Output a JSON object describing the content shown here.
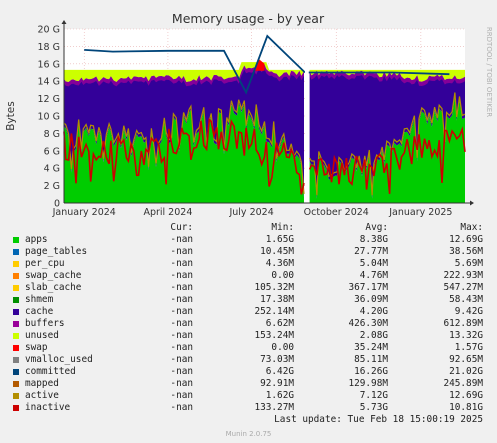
{
  "chart_data": {
    "type": "area",
    "title": "Memory usage - by year",
    "ylabel": "Bytes",
    "watermark": "RRDTOOL / TOBI OETIKER",
    "ylim": [
      0,
      20
    ],
    "y_unit": "G",
    "y_ticks": [
      "0",
      "2 G",
      "4 G",
      "6 G",
      "8 G",
      "10 G",
      "12 G",
      "14 G",
      "16 G",
      "18 G",
      "20 G"
    ],
    "x_ticks": [
      {
        "label": "January 2024",
        "date": "2024-01-01"
      },
      {
        "label": "April 2024",
        "date": "2024-04-01"
      },
      {
        "label": "July 2024",
        "date": "2024-07-01"
      },
      {
        "label": "October 2024",
        "date": "2024-10-01"
      },
      {
        "label": "January 2025",
        "date": "2025-01-01"
      }
    ],
    "x_range": [
      "2023-12-10",
      "2025-02-18"
    ],
    "gap": [
      "2024-08-28",
      "2024-09-01"
    ],
    "stack_top_typical": 15.3,
    "stack_top_july_spike": 16.2,
    "series": [
      {
        "name": "apps",
        "color": "#00cc00",
        "x": [
          "2024-01",
          "2024-03",
          "2024-05",
          "2024-07",
          "2024-09",
          "2024-11",
          "2025-01",
          "2025-02"
        ],
        "values": [
          8.5,
          6.5,
          9.5,
          10.0,
          4.0,
          4.5,
          9.0,
          11.0
        ]
      },
      {
        "name": "cache",
        "color": "#330099",
        "x": [
          "2024-01",
          "2024-03",
          "2024-05",
          "2024-07",
          "2024-09",
          "2024-11",
          "2025-01",
          "2025-02"
        ],
        "values": [
          4.5,
          6.5,
          3.5,
          3.5,
          10.5,
          10.0,
          4.5,
          3.0
        ]
      },
      {
        "name": "unused",
        "color": "#ccff00",
        "x": [
          "2024-01",
          "2024-03",
          "2024-05",
          "2024-07",
          "2024-09",
          "2024-11",
          "2025-01",
          "2025-02"
        ],
        "values": [
          1.0,
          1.0,
          1.0,
          0.6,
          0.3,
          0.3,
          1.0,
          0.8
        ]
      },
      {
        "name": "committed",
        "color": "#00457a",
        "x": [
          "2024-01",
          "2024-02",
          "2024-04",
          "2024-06",
          "2024-06-25",
          "2024-07-18",
          "2024-08-28",
          "2024-09-01",
          "2024-12",
          "2025-02"
        ],
        "values": [
          17.6,
          17.4,
          17.5,
          17.5,
          12.7,
          19.2,
          15.0,
          15.0,
          15.0,
          14.8
        ]
      },
      {
        "name": "inactive",
        "color": "#cc0000",
        "x": [
          "2024-01",
          "2024-03",
          "2024-05",
          "2024-07",
          "2024-09",
          "2024-11",
          "2025-01",
          "2025-02"
        ],
        "values": [
          6.5,
          5.5,
          8.0,
          7.5,
          3.5,
          4.0,
          6.5,
          7.0
        ]
      }
    ]
  },
  "legend": {
    "header": {
      "cur": "Cur:",
      "min": "Min:",
      "avg": "Avg:",
      "max": "Max:"
    },
    "rows": [
      {
        "name": "apps",
        "color": "#00cc00",
        "cur": "-nan",
        "min": "1.65G",
        "avg": "8.38G",
        "max": "12.69G"
      },
      {
        "name": "page_tables",
        "color": "#0066b3",
        "cur": "-nan",
        "min": "10.45M",
        "avg": "27.77M",
        "max": "38.56M"
      },
      {
        "name": "per_cpu",
        "color": "#ffcc00",
        "cur": "-nan",
        "min": "4.36M",
        "avg": "5.04M",
        "max": "5.69M"
      },
      {
        "name": "swap_cache",
        "color": "#ff8000",
        "cur": "-nan",
        "min": "0.00",
        "avg": "4.76M",
        "max": "222.93M"
      },
      {
        "name": "slab_cache",
        "color": "#ffcc00",
        "cur": "-nan",
        "min": "105.32M",
        "avg": "367.17M",
        "max": "547.27M"
      },
      {
        "name": "shmem",
        "color": "#008f00",
        "cur": "-nan",
        "min": "17.38M",
        "avg": "36.09M",
        "max": "58.43M"
      },
      {
        "name": "cache",
        "color": "#330099",
        "cur": "-nan",
        "min": "252.14M",
        "avg": "4.20G",
        "max": "9.42G"
      },
      {
        "name": "buffers",
        "color": "#990099",
        "cur": "-nan",
        "min": "6.62M",
        "avg": "426.30M",
        "max": "612.89M"
      },
      {
        "name": "unused",
        "color": "#ccff00",
        "cur": "-nan",
        "min": "153.24M",
        "avg": "2.08G",
        "max": "13.32G"
      },
      {
        "name": "swap",
        "color": "#ff0000",
        "cur": "-nan",
        "min": "0.00",
        "avg": "35.24M",
        "max": "1.57G"
      },
      {
        "name": "vmalloc_used",
        "color": "#808080",
        "cur": "-nan",
        "min": "73.03M",
        "avg": "85.11M",
        "max": "92.65M"
      },
      {
        "name": "committed",
        "color": "#00457a",
        "cur": "-nan",
        "min": "6.42G",
        "avg": "16.26G",
        "max": "21.02G"
      },
      {
        "name": "mapped",
        "color": "#b35a00",
        "cur": "-nan",
        "min": "92.91M",
        "avg": "129.98M",
        "max": "245.89M"
      },
      {
        "name": "active",
        "color": "#b38f00",
        "cur": "-nan",
        "min": "1.62G",
        "avg": "7.12G",
        "max": "12.69G"
      },
      {
        "name": "inactive",
        "color": "#cc0000",
        "cur": "-nan",
        "min": "133.27M",
        "avg": "5.73G",
        "max": "10.81G"
      }
    ]
  },
  "footer": {
    "last_update": "Last update: Tue Feb 18 15:00:19 2025",
    "generator": "Munin 2.0.75"
  }
}
